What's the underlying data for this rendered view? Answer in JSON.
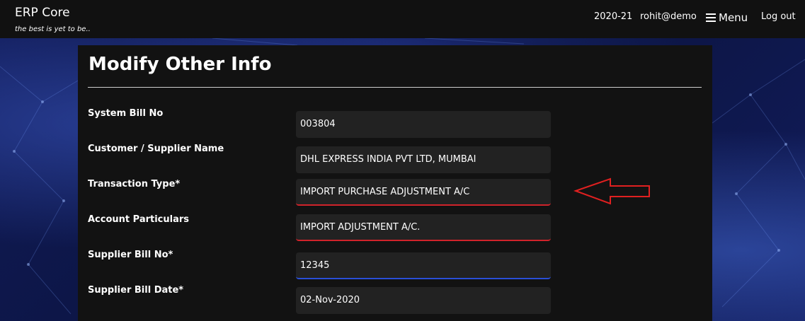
{
  "navbar": {
    "brand": "ERP Core",
    "tagline": "the best is yet to be..",
    "year": "2020-21",
    "user": "rohit@demo",
    "menu_label": "Menu",
    "logout_label": "Log out"
  },
  "page": {
    "title": "Modify Other Info"
  },
  "form": {
    "system_bill_no": {
      "label": "System Bill No",
      "value": "003804"
    },
    "customer_supplier_name": {
      "label": "Customer / Supplier Name",
      "value": "DHL EXPRESS INDIA PVT LTD, MUMBAI"
    },
    "transaction_type": {
      "label": "Transaction Type*",
      "value": "IMPORT PURCHASE ADJUSTMENT A/C"
    },
    "account_particulars": {
      "label": "Account Particulars",
      "value": "IMPORT ADJUSTMENT A/C."
    },
    "supplier_bill_no": {
      "label": "Supplier Bill No*",
      "value": "12345"
    },
    "supplier_bill_date": {
      "label": "Supplier Bill Date*",
      "value": "02-Nov-2020"
    }
  },
  "colors": {
    "invalid_border": "#d0232a",
    "focus_border": "#2a4fd6",
    "annotation_arrow": "#e02020"
  },
  "icons": {
    "menu": "hamburger-icon",
    "annotation": "left-arrow-annotation"
  }
}
